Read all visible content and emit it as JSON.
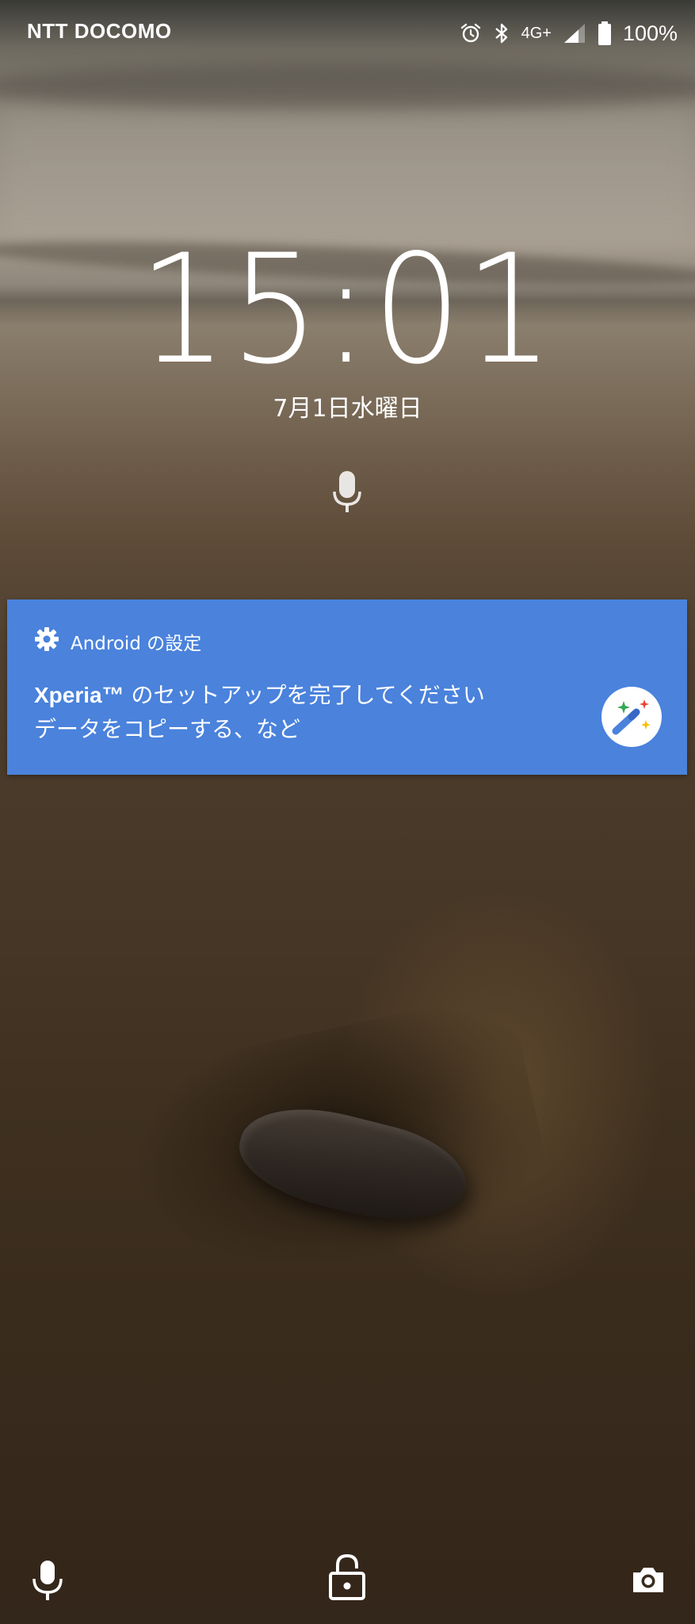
{
  "status_bar": {
    "carrier": "NTT DOCOMO",
    "network": "4G+",
    "battery_percent": "100%",
    "icons": [
      "alarm-icon",
      "bluetooth-icon",
      "signal-icon",
      "battery-icon"
    ]
  },
  "lock_screen": {
    "time": "15:01",
    "date": "7月1日水曜日"
  },
  "notification": {
    "app_name": "Android の設定",
    "title_brand": "Xperia™",
    "title_rest": " のセットアップを完了してください",
    "text": "データをコピーする、など",
    "app_icon": "gear-icon",
    "large_icon": "magic-wand-icon",
    "background_color": "#4a82dc"
  },
  "bottom_bar": {
    "left_icon": "microphone-icon",
    "center_icon": "lock-icon",
    "right_icon": "camera-icon"
  }
}
